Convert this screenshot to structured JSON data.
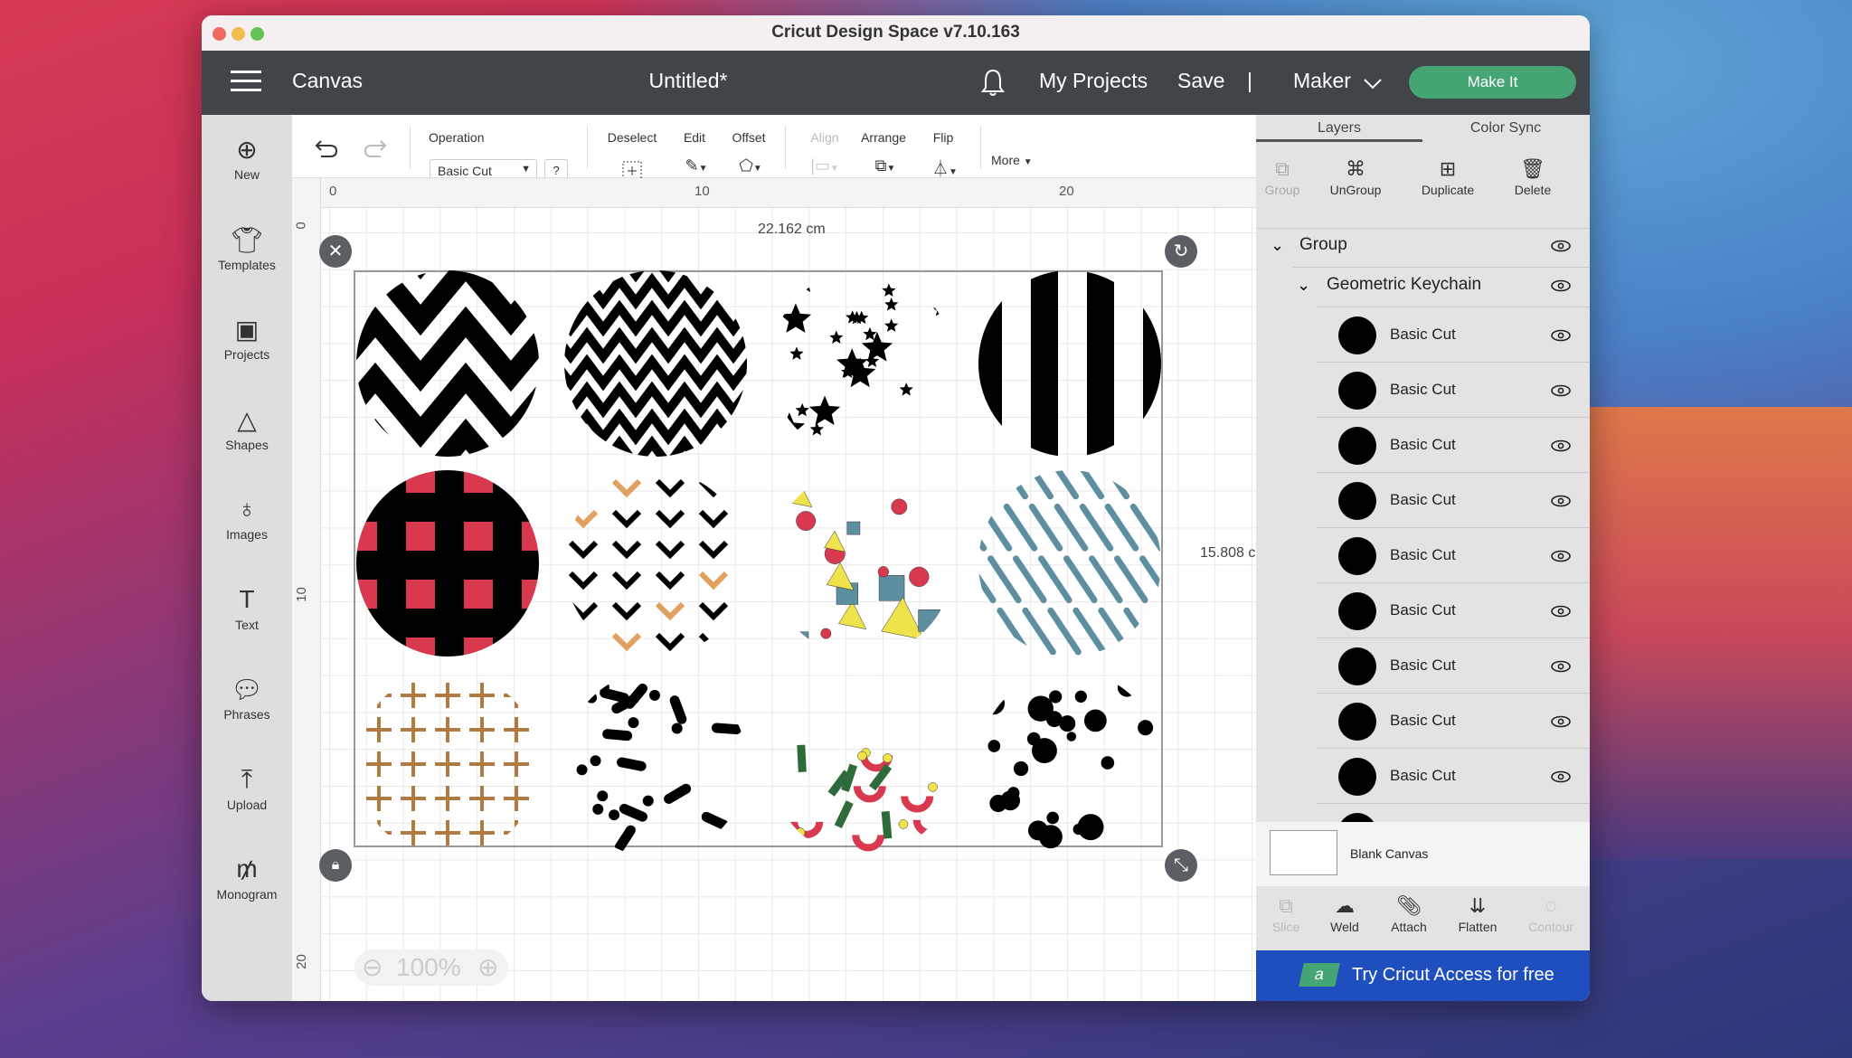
{
  "window": {
    "title": "Cricut Design Space  v7.10.163"
  },
  "header": {
    "canvas": "Canvas",
    "doc_title": "Untitled*",
    "my_projects": "My Projects",
    "save": "Save",
    "separator": "|",
    "machine": "Maker",
    "make_it": "Make It"
  },
  "sidebar": {
    "items": [
      {
        "label": "New",
        "icon": "plus-circle-icon"
      },
      {
        "label": "Templates",
        "icon": "tshirt-icon"
      },
      {
        "label": "Projects",
        "icon": "projects-icon"
      },
      {
        "label": "Shapes",
        "icon": "shapes-icon"
      },
      {
        "label": "Images",
        "icon": "balloon-icon"
      },
      {
        "label": "Text",
        "icon": "text-icon"
      },
      {
        "label": "Phrases",
        "icon": "speech-icon"
      },
      {
        "label": "Upload",
        "icon": "upload-icon"
      },
      {
        "label": "Monogram",
        "icon": "monogram-icon"
      }
    ]
  },
  "toolbar": {
    "operation_label": "Operation",
    "operation_value": "Basic Cut",
    "help": "?",
    "deselect": "Deselect",
    "edit": "Edit",
    "offset": "Offset",
    "align": "Align",
    "arrange": "Arrange",
    "flip": "Flip",
    "more": "More"
  },
  "canvas": {
    "ruler_x": [
      "0",
      "10",
      "20"
    ],
    "ruler_y": [
      "0",
      "10",
      "20"
    ],
    "width_readout": "22.162 cm",
    "height_readout": "15.808 c",
    "zoom": "100%"
  },
  "layers": {
    "tabs": [
      "Layers",
      "Color Sync"
    ],
    "actions": [
      "Group",
      "UnGroup",
      "Duplicate",
      "Delete"
    ],
    "group": "Group",
    "subgroup": "Geometric Keychain",
    "items": [
      "Basic Cut",
      "Basic Cut",
      "Basic Cut",
      "Basic Cut",
      "Basic Cut",
      "Basic Cut",
      "Basic Cut",
      "Basic Cut",
      "Basic Cut"
    ],
    "blank_canvas": "Blank Canvas",
    "bottom_actions": [
      "Slice",
      "Weld",
      "Attach",
      "Flatten",
      "Contour"
    ],
    "banner": "Try Cricut Access for free",
    "banner_logo": "a"
  },
  "colors": {
    "header": "#414448",
    "make_it": "#46a574",
    "banner": "#1f4fbf",
    "red": "#d8394f",
    "blue": "#5e8fa0",
    "yellow": "#f0e24a",
    "orange": "#e0a060",
    "tan": "#b07a40",
    "green": "#2e6b3a"
  }
}
